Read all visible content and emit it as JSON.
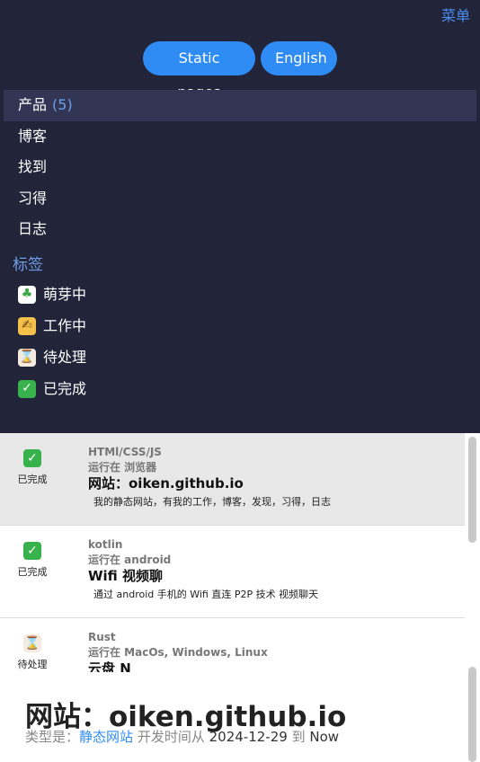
{
  "header": {
    "menu_label": "菜单"
  },
  "pills": {
    "static_pages": "Static pages",
    "language": "English"
  },
  "nav": {
    "items": [
      {
        "label": "产品",
        "count": "(5)",
        "active": true
      },
      {
        "label": "博客"
      },
      {
        "label": "找到"
      },
      {
        "label": "习得"
      },
      {
        "label": "日志"
      }
    ]
  },
  "tags": {
    "title": "标签",
    "items": [
      {
        "label": "萌芽中",
        "icon": "seedling-icon"
      },
      {
        "label": "工作中",
        "icon": "writing-hand-icon"
      },
      {
        "label": "待处理",
        "icon": "hourglass-icon"
      },
      {
        "label": "已完成",
        "icon": "check-mark-icon"
      }
    ]
  },
  "projects": [
    {
      "status_label": "已完成",
      "status_icon": "check-mark-icon",
      "tech": "HTMl/CSS/JS",
      "runs_on": "运行在 浏览器",
      "title": "网站：oiken.github.io",
      "desc": "我的静态网站，有我的工作，博客，发现，习得，日志"
    },
    {
      "status_label": "已完成",
      "status_icon": "check-mark-icon",
      "tech": "kotlin",
      "runs_on": "运行在 android",
      "title": "Wifi 视频聊",
      "desc": "通过 android 手机的 Wifi 直连 P2P 技术 视频聊天"
    },
    {
      "status_label": "待处理",
      "status_icon": "hourglass-icon",
      "tech": "Rust",
      "runs_on": "运行在 MacOs, Windows, Linux",
      "title": "云盘 N",
      "desc": ""
    }
  ],
  "detail": {
    "title": "网站：oiken.github.io",
    "type_prefix": "类型是：",
    "type_value": "静态网站",
    "dev_prefix": "开发时间从",
    "start_date": "2024-12-29",
    "to_word": "到",
    "end_value": "Now"
  },
  "colors": {
    "nav_bg": "#22253a",
    "accent": "#2f8cf5",
    "tag_title": "#6c9de6"
  }
}
